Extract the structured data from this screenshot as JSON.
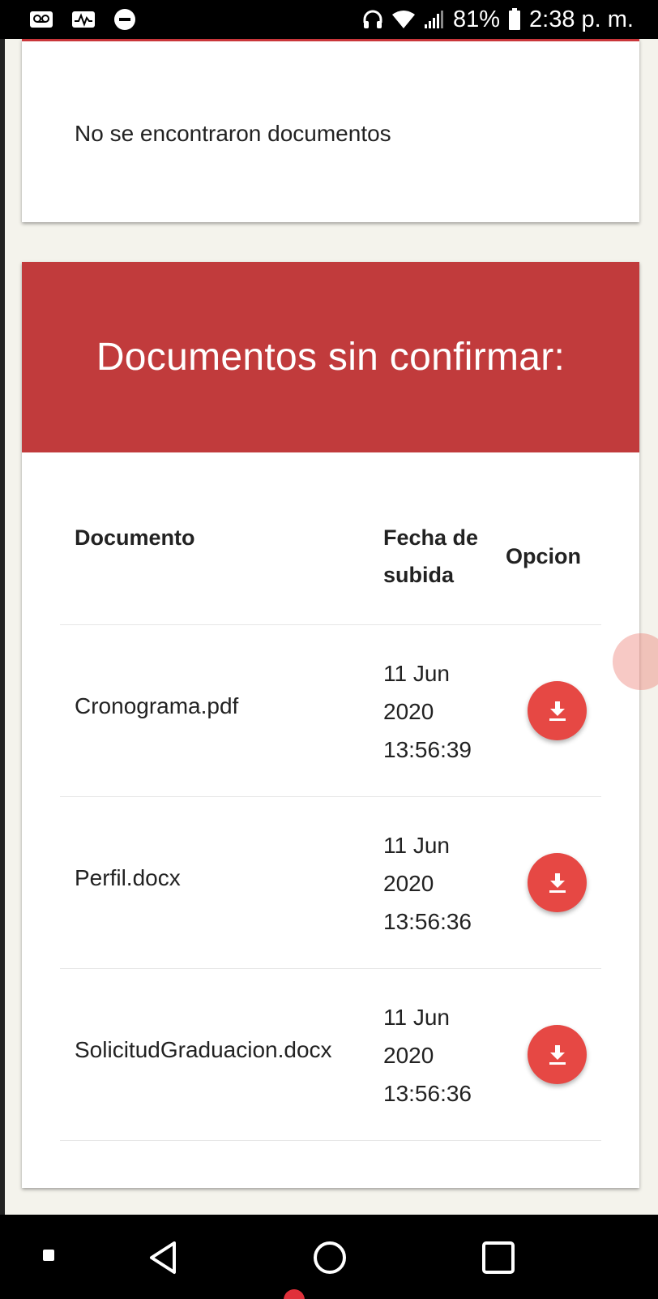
{
  "status_bar": {
    "battery": "81%",
    "time": "2:38 p. m.",
    "left_icons": [
      "voicemail-icon",
      "activity-icon",
      "do-not-disturb-icon"
    ],
    "right_icons": [
      "headphones-icon",
      "wifi-icon",
      "signal-icon",
      "battery-icon"
    ]
  },
  "empty_card": {
    "message": "No se encontraron documentos"
  },
  "documents": {
    "title": "Documentos sin confirmar:",
    "header_color": "#c13b3c",
    "columns": [
      "Documento",
      "Fecha de subida",
      "Opcion"
    ],
    "rows": [
      {
        "name": "Cronograma.pdf",
        "date_day": "11 Jun",
        "date_year": "2020",
        "date_time": "13:56:39",
        "action_icon": "download-icon"
      },
      {
        "name": "Perfil.docx",
        "date_day": "11 Jun",
        "date_year": "2020",
        "date_time": "13:56:36",
        "action_icon": "download-icon"
      },
      {
        "name": "SolicitudGraduacion.docx",
        "date_day": "11 Jun",
        "date_year": "2020",
        "date_time": "13:56:36",
        "action_icon": "download-icon"
      }
    ],
    "button_color": "#e64844"
  },
  "nav_bar": {
    "buttons": [
      "dot-icon",
      "back-icon",
      "home-icon",
      "recents-icon"
    ]
  }
}
